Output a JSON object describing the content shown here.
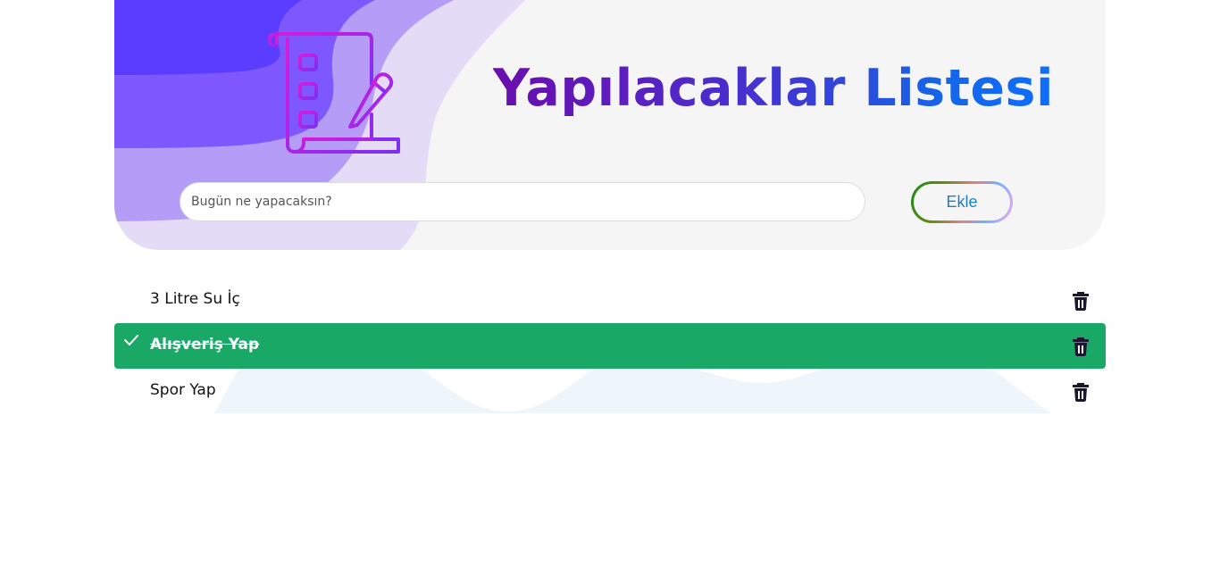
{
  "header": {
    "title": "Yapılacaklar Listesi",
    "logo_icon": "checklist-pencil-icon"
  },
  "form": {
    "input_placeholder": "Bugün ne yapacaksın?",
    "input_value": "",
    "add_button_label": "Ekle"
  },
  "todos": [
    {
      "text": "3 Litre Su İç",
      "checked": false
    },
    {
      "text": "Alışveriş Yap",
      "checked": true
    },
    {
      "text": "Spor Yap",
      "checked": false
    }
  ],
  "colors": {
    "checked_background": "#1aa867",
    "title_gradient_start": "#6a0dad",
    "title_gradient_end": "#0d6efd",
    "header_background": "#f5f5f5"
  }
}
